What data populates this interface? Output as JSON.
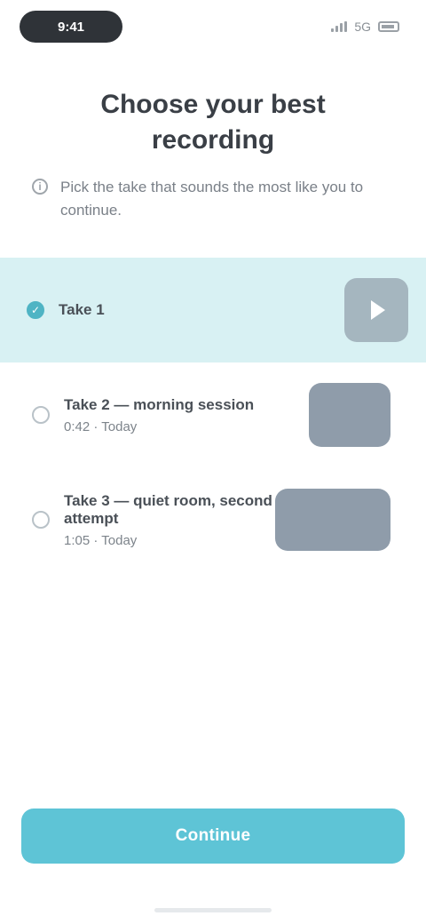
{
  "status_bar": {
    "time": "9:41",
    "network": "5G"
  },
  "header": {
    "title": "Choose your best recording"
  },
  "info": {
    "text": "Pick the take that sounds the most like you to continue."
  },
  "recordings": [
    {
      "title": "Take 1",
      "meta": "",
      "selected": true,
      "thumb": "play"
    },
    {
      "title": "Take 2 — morning session",
      "meta": "0:42 · Today",
      "selected": false,
      "thumb": "wide"
    },
    {
      "title": "Take 3 — quiet room, second attempt",
      "meta": "1:05 · Today",
      "selected": false,
      "thumb": "wider"
    }
  ],
  "actions": {
    "continue_label": "Continue"
  },
  "colors": {
    "accent": "#5ec4d6",
    "selected_row": "#d8f1f3",
    "status_pill": "#2f3338",
    "thumbnail": "#8f9caa"
  }
}
